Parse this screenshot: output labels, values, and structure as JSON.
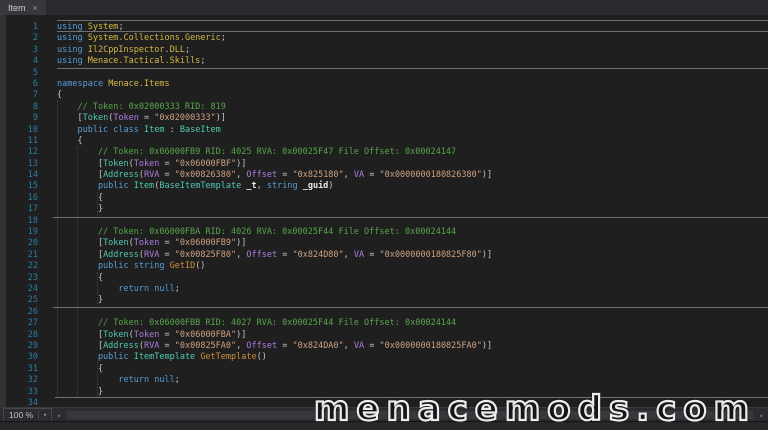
{
  "tab": {
    "title": "Item"
  },
  "icons": {
    "tab_close": "×",
    "zoom_dropdown": "▾",
    "scroll_left": "◂",
    "scroll_right": "▸"
  },
  "zoom_control": {
    "value": "100 %"
  },
  "watermark": {
    "text": "menacemods.com"
  },
  "colors": {
    "editor_bg": "#1f1f1f",
    "tab_bg": "#37373c",
    "keyword": "#569cd6",
    "type": "#4ec9b0",
    "namespace": "#d5b843",
    "method": "#d18f3f",
    "comment": "#57a64a",
    "attr_param": "#ad7de0",
    "string": "#cfa182",
    "line_number": "#2a7ea6"
  },
  "editor": {
    "lines": [
      {
        "n": 1,
        "segs": [
          [
            "k",
            "using "
          ],
          [
            "n",
            "System"
          ],
          [
            "p",
            ";"
          ]
        ]
      },
      {
        "n": 2,
        "segs": [
          [
            "k",
            "using "
          ],
          [
            "n",
            "System.Collections.Generic"
          ],
          [
            "p",
            ";"
          ]
        ]
      },
      {
        "n": 3,
        "segs": [
          [
            "k",
            "using "
          ],
          [
            "n",
            "Il2CppInspector.DLL"
          ],
          [
            "p",
            ";"
          ]
        ]
      },
      {
        "n": 4,
        "segs": [
          [
            "k",
            "using "
          ],
          [
            "n",
            "Menace.Tactical.Skills"
          ],
          [
            "p",
            ";"
          ]
        ]
      },
      {
        "n": 5,
        "segs": []
      },
      {
        "n": 6,
        "segs": [
          [
            "k",
            "namespace "
          ],
          [
            "n",
            "Menace.Items"
          ]
        ]
      },
      {
        "n": 7,
        "segs": [
          [
            "p",
            "{"
          ]
        ]
      },
      {
        "n": 8,
        "segs": [
          [
            "c",
            "    // Token: 0x02000333 RID: 819"
          ]
        ]
      },
      {
        "n": 9,
        "segs": [
          [
            "p",
            "    ["
          ],
          [
            "t",
            "Token"
          ],
          [
            "p",
            "("
          ],
          [
            "a",
            "Token"
          ],
          [
            "p",
            " = "
          ],
          [
            "s",
            "\"0x02000333\""
          ],
          [
            "p",
            ")]"
          ]
        ]
      },
      {
        "n": 10,
        "segs": [
          [
            "k",
            "    public class "
          ],
          [
            "t",
            "Item"
          ],
          [
            "p",
            " : "
          ],
          [
            "t",
            "BaseItem"
          ]
        ]
      },
      {
        "n": 11,
        "segs": [
          [
            "p",
            "    {"
          ]
        ]
      },
      {
        "n": 12,
        "segs": [
          [
            "c",
            "        // Token: 0x06000FB9 RID: 4025 RVA: 0x00025F47 File Offset: 0x00024147"
          ]
        ]
      },
      {
        "n": 13,
        "segs": [
          [
            "p",
            "        ["
          ],
          [
            "t",
            "Token"
          ],
          [
            "p",
            "("
          ],
          [
            "a",
            "Token"
          ],
          [
            "p",
            " = "
          ],
          [
            "s",
            "\"0x06000FBF\""
          ],
          [
            "p",
            ")]"
          ]
        ]
      },
      {
        "n": 14,
        "segs": [
          [
            "p",
            "        ["
          ],
          [
            "t",
            "Address"
          ],
          [
            "p",
            "("
          ],
          [
            "a",
            "RVA"
          ],
          [
            "p",
            " = "
          ],
          [
            "s",
            "\"0x00826380\""
          ],
          [
            "p",
            ", "
          ],
          [
            "a",
            "Offset"
          ],
          [
            "p",
            " = "
          ],
          [
            "s",
            "\"0x825180\""
          ],
          [
            "p",
            ", "
          ],
          [
            "a",
            "VA"
          ],
          [
            "p",
            " = "
          ],
          [
            "s",
            "\"0x0000000180826380\""
          ],
          [
            "p",
            ")]"
          ]
        ]
      },
      {
        "n": 15,
        "segs": [
          [
            "k",
            "        public "
          ],
          [
            "t",
            "Item"
          ],
          [
            "p",
            "("
          ],
          [
            "t",
            "BaseItemTemplate"
          ],
          [
            "v",
            " _t"
          ],
          [
            "p",
            ", "
          ],
          [
            "k",
            "string"
          ],
          [
            "v",
            " _guid"
          ],
          [
            "p",
            ")"
          ]
        ]
      },
      {
        "n": 16,
        "segs": [
          [
            "p",
            "        {"
          ]
        ]
      },
      {
        "n": 17,
        "segs": [
          [
            "p",
            "        }"
          ]
        ]
      },
      {
        "n": 18,
        "segs": []
      },
      {
        "n": 19,
        "segs": [
          [
            "c",
            "        // Token: 0x06000FBA RID: 4026 RVA: 0x00025F44 File Offset: 0x00024144"
          ]
        ]
      },
      {
        "n": 20,
        "segs": [
          [
            "p",
            "        ["
          ],
          [
            "t",
            "Token"
          ],
          [
            "p",
            "("
          ],
          [
            "a",
            "Token"
          ],
          [
            "p",
            " = "
          ],
          [
            "s",
            "\"0x06000FB9\""
          ],
          [
            "p",
            ")]"
          ]
        ]
      },
      {
        "n": 21,
        "segs": [
          [
            "p",
            "        ["
          ],
          [
            "t",
            "Address"
          ],
          [
            "p",
            "("
          ],
          [
            "a",
            "RVA"
          ],
          [
            "p",
            " = "
          ],
          [
            "s",
            "\"0x00825F80\""
          ],
          [
            "p",
            ", "
          ],
          [
            "a",
            "Offset"
          ],
          [
            "p",
            " = "
          ],
          [
            "s",
            "\"0x824D80\""
          ],
          [
            "p",
            ", "
          ],
          [
            "a",
            "VA"
          ],
          [
            "p",
            " = "
          ],
          [
            "s",
            "\"0x0000000180825F80\""
          ],
          [
            "p",
            ")]"
          ]
        ]
      },
      {
        "n": 22,
        "segs": [
          [
            "k",
            "        public string "
          ],
          [
            "m",
            "GetID"
          ],
          [
            "p",
            "()"
          ]
        ]
      },
      {
        "n": 23,
        "segs": [
          [
            "p",
            "        {"
          ]
        ]
      },
      {
        "n": 24,
        "segs": [
          [
            "k",
            "            return null"
          ],
          [
            "p",
            ";"
          ]
        ]
      },
      {
        "n": 25,
        "segs": [
          [
            "p",
            "        }"
          ]
        ]
      },
      {
        "n": 26,
        "segs": []
      },
      {
        "n": 27,
        "segs": [
          [
            "c",
            "        // Token: 0x06000FBB RID: 4027 RVA: 0x00025F44 File Offset: 0x00024144"
          ]
        ]
      },
      {
        "n": 28,
        "segs": [
          [
            "p",
            "        ["
          ],
          [
            "t",
            "Token"
          ],
          [
            "p",
            "("
          ],
          [
            "a",
            "Token"
          ],
          [
            "p",
            " = "
          ],
          [
            "s",
            "\"0x06000FBA\""
          ],
          [
            "p",
            ")]"
          ]
        ]
      },
      {
        "n": 29,
        "segs": [
          [
            "p",
            "        ["
          ],
          [
            "t",
            "Address"
          ],
          [
            "p",
            "("
          ],
          [
            "a",
            "RVA"
          ],
          [
            "p",
            " = "
          ],
          [
            "s",
            "\"0x00825FA0\""
          ],
          [
            "p",
            ", "
          ],
          [
            "a",
            "Offset"
          ],
          [
            "p",
            " = "
          ],
          [
            "s",
            "\"0x824DA0\""
          ],
          [
            "p",
            ", "
          ],
          [
            "a",
            "VA"
          ],
          [
            "p",
            " = "
          ],
          [
            "s",
            "\"0x0000000180825FA0\""
          ],
          [
            "p",
            ")]"
          ]
        ]
      },
      {
        "n": 30,
        "segs": [
          [
            "k",
            "        public "
          ],
          [
            "t",
            "ItemTemplate"
          ],
          [
            "p",
            " "
          ],
          [
            "m",
            "GetTemplate"
          ],
          [
            "p",
            "()"
          ]
        ]
      },
      {
        "n": 31,
        "segs": [
          [
            "p",
            "        {"
          ]
        ]
      },
      {
        "n": 32,
        "segs": [
          [
            "k",
            "            return null"
          ],
          [
            "p",
            ";"
          ]
        ]
      },
      {
        "n": 33,
        "segs": [
          [
            "p",
            "        }"
          ]
        ]
      },
      {
        "n": 34,
        "segs": []
      }
    ]
  }
}
